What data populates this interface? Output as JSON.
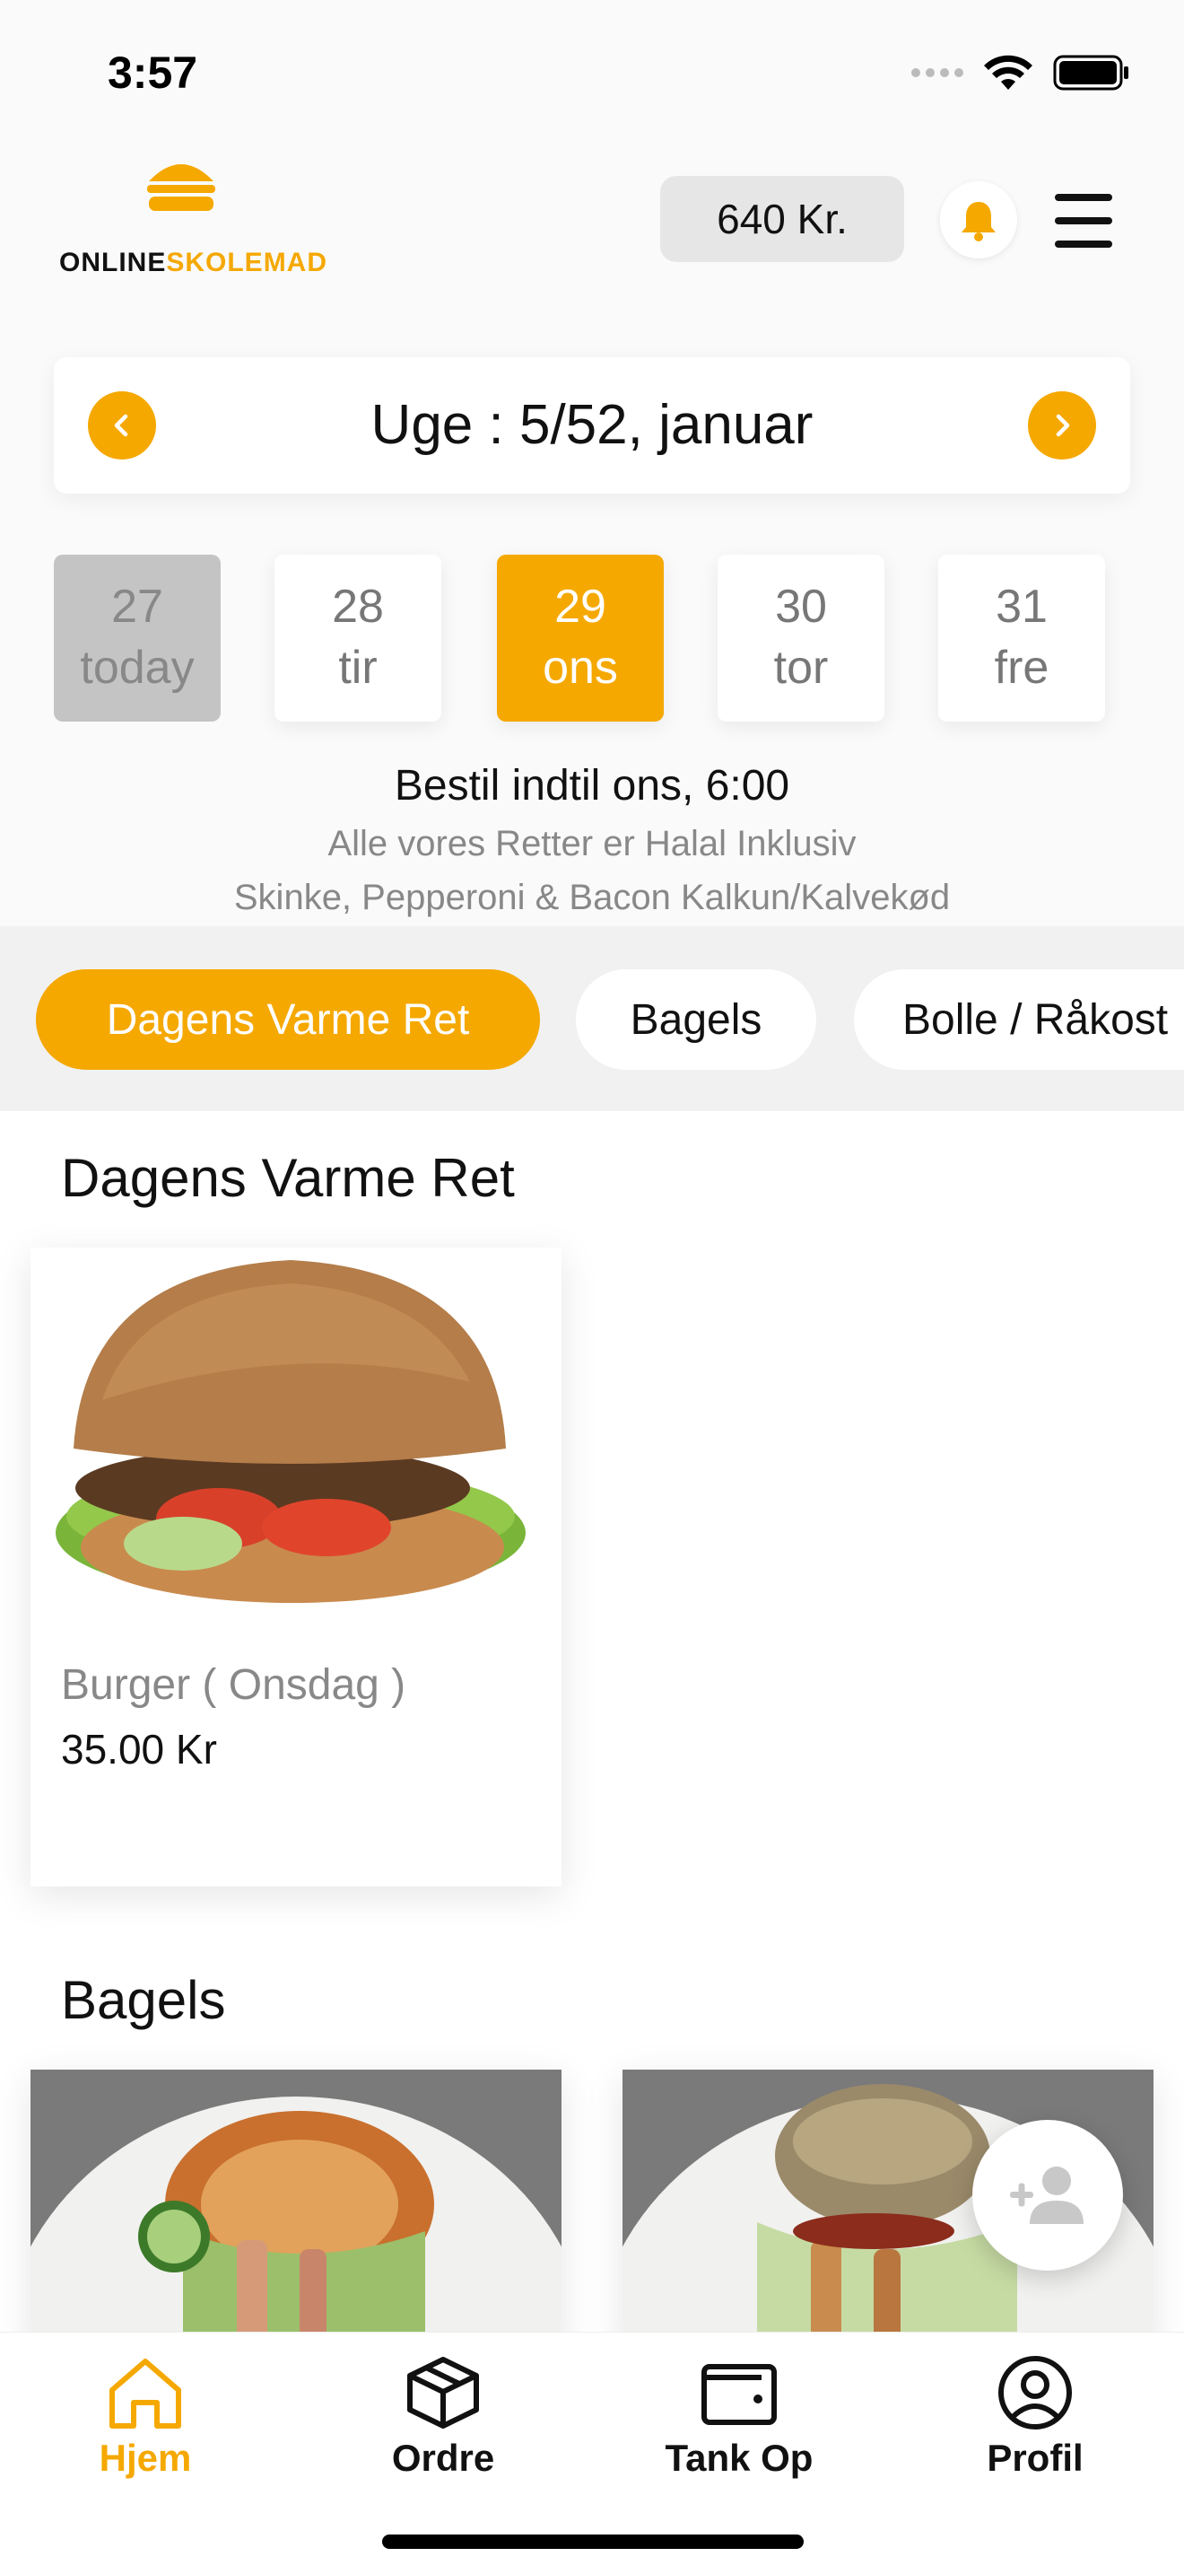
{
  "status_bar": {
    "time": "3:57"
  },
  "header": {
    "logo_text_part1": "ONLINE",
    "logo_text_part2": "SKOLEMAD",
    "balance": "640 Kr."
  },
  "week": {
    "label": "Uge : 5/52, januar"
  },
  "days": [
    {
      "num": "27",
      "name": "today",
      "state": "today"
    },
    {
      "num": "28",
      "name": "tir",
      "state": "normal"
    },
    {
      "num": "29",
      "name": "ons",
      "state": "selected"
    },
    {
      "num": "30",
      "name": "tor",
      "state": "normal"
    },
    {
      "num": "31",
      "name": "fre",
      "state": "normal"
    }
  ],
  "order_info": {
    "deadline": "Bestil indtil ons, 6:00",
    "halal_line1": "Alle vores Retter er Halal Inklusiv",
    "halal_line2": "Skinke, Pepperoni & Bacon Kalkun/Kalvekød"
  },
  "categories": [
    {
      "label": "Dagens Varme Ret",
      "active": true
    },
    {
      "label": "Bagels",
      "active": false
    },
    {
      "label": "Bolle / Råkost",
      "active": false
    }
  ],
  "sections": {
    "hot_dish": {
      "title": "Dagens Varme Ret",
      "items": [
        {
          "name": "Burger ( Onsdag )",
          "price": "35.00 Kr"
        }
      ]
    },
    "bagels": {
      "title": "Bagels"
    }
  },
  "nav": [
    {
      "label": "Hjem",
      "icon": "home-icon",
      "active": true
    },
    {
      "label": "Ordre",
      "icon": "box-icon",
      "active": false
    },
    {
      "label": "Tank Op",
      "icon": "wallet-icon",
      "active": false
    },
    {
      "label": "Profil",
      "icon": "profile-icon",
      "active": false
    }
  ],
  "colors": {
    "accent": "#f5a800",
    "today_bg": "#c4c4c4"
  }
}
